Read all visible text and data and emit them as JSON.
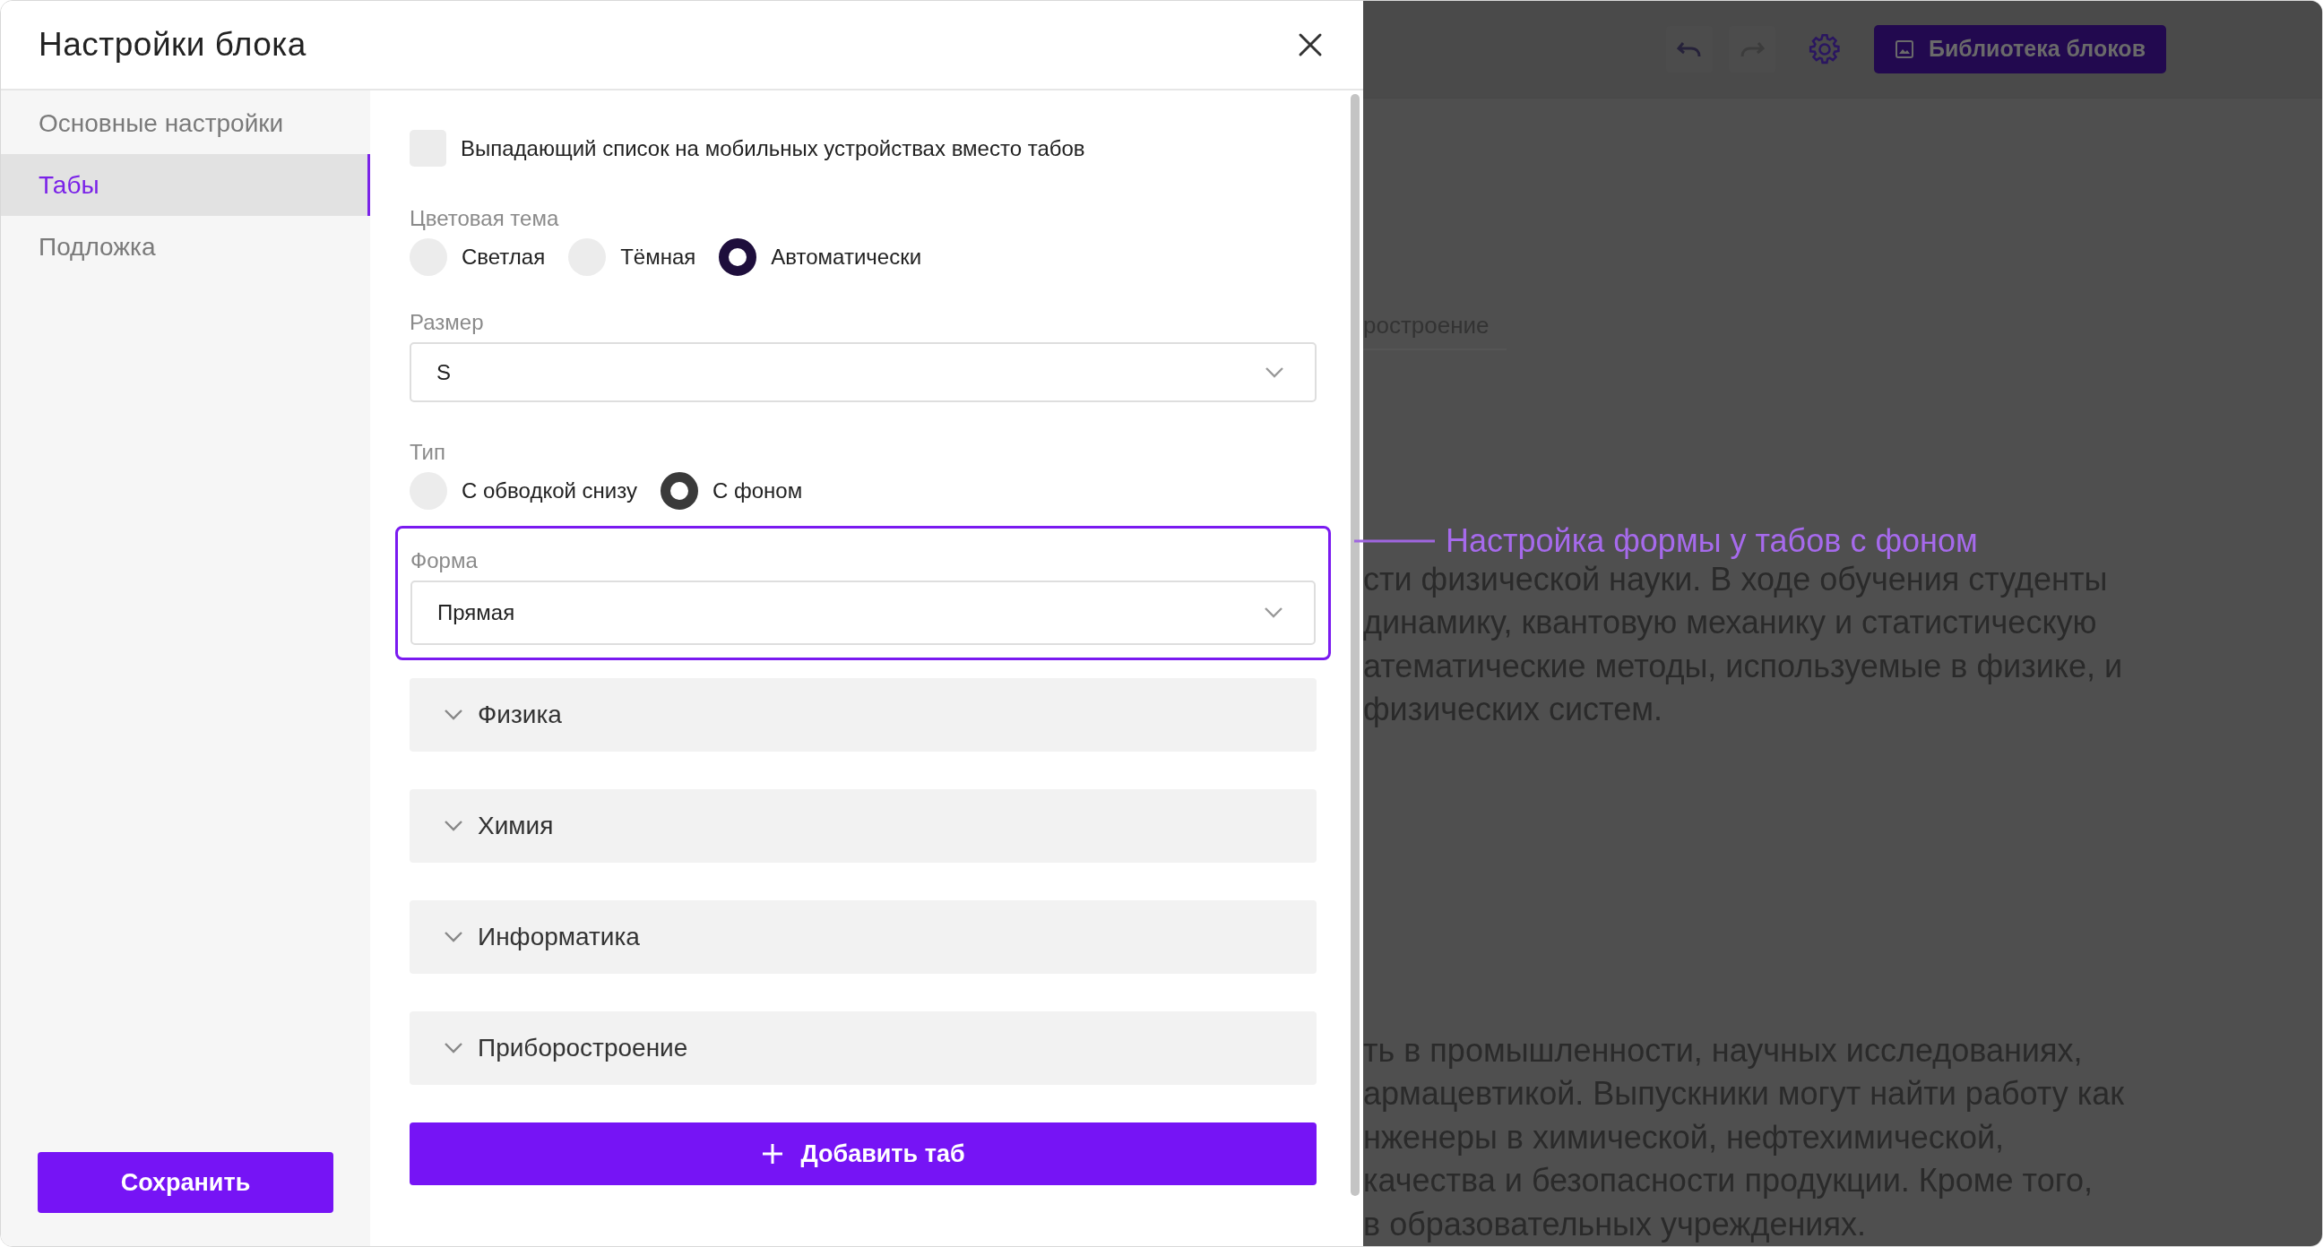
{
  "dialog": {
    "title": "Настройки блока",
    "sidebar": {
      "items": [
        {
          "label": "Основные настройки",
          "selected": false
        },
        {
          "label": "Табы",
          "selected": true
        },
        {
          "label": "Подложка",
          "selected": false
        }
      ]
    },
    "save_button": "Сохранить",
    "mobile_dropdown": {
      "label": "Выпадающий список на мобильных устройствах вместо табов",
      "checked": false
    },
    "color_theme": {
      "label": "Цветовая тема",
      "options": [
        {
          "label": "Светлая",
          "selected": false
        },
        {
          "label": "Тёмная",
          "selected": false
        },
        {
          "label": "Автоматически",
          "selected": true
        }
      ]
    },
    "size": {
      "label": "Размер",
      "value": "S"
    },
    "type": {
      "label": "Тип",
      "options": [
        {
          "label": "С обводкой снизу",
          "selected": false
        },
        {
          "label": "С фоном",
          "selected": true
        }
      ]
    },
    "shape": {
      "label": "Форма",
      "value": "Прямая",
      "highlighted": true
    },
    "tabs": [
      {
        "label": "Физика",
        "expanded": false
      },
      {
        "label": "Химия",
        "expanded": false
      },
      {
        "label": "Информатика",
        "expanded": false
      },
      {
        "label": "Приборостроение",
        "expanded": false
      }
    ],
    "add_button": "Добавить таб"
  },
  "annotation": "Настройка формы у табов с фоном",
  "background": {
    "library_button": "Библиотека блоков",
    "tab_fragment": "ростроение",
    "paragraphs": [
      [
        "сти физической науки. В ходе обучения студенты",
        "динамику, квантовую механику и статистическую",
        "атематические методы, используемые в физике, и",
        "физических систем."
      ],
      [
        "ть в промышленности, научных исследованиях,",
        "армацевтикой. Выпускники могут найти работу как",
        "нженеры в химической, нефтехимической,",
        "качества и безопасности продукции. Кроме того,",
        "в образовательных учреждениях."
      ]
    ]
  }
}
